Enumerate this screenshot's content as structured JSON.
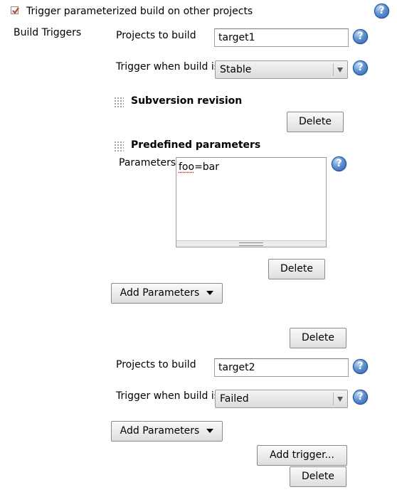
{
  "header": {
    "checkbox_label": "Trigger parameterized build on other projects",
    "checked": true
  },
  "section_label": "Build Triggers",
  "triggers": [
    {
      "projects_label": "Projects to build",
      "projects_value": "target1",
      "trigger_label": "Trigger when build is",
      "trigger_value": "Stable",
      "subversion": {
        "title": "Subversion revision",
        "delete_label": "Delete"
      },
      "predefined": {
        "title": "Predefined parameters",
        "params_label": "Parameters",
        "params_value_word1": "foo",
        "params_value_rest": "=bar",
        "delete_label": "Delete"
      },
      "add_parameters_label": "Add Parameters",
      "delete_label": "Delete"
    },
    {
      "projects_label": "Projects to build",
      "projects_value": "target2",
      "trigger_label": "Trigger when build is",
      "trigger_value": "Failed",
      "add_parameters_label": "Add Parameters"
    }
  ],
  "add_trigger_label": "Add trigger...",
  "final_delete_label": "Delete",
  "help_glyph": "?",
  "icons": {
    "help": "help-question-icon",
    "handle": "drag-handle-icon",
    "check": "checkmark-icon"
  }
}
